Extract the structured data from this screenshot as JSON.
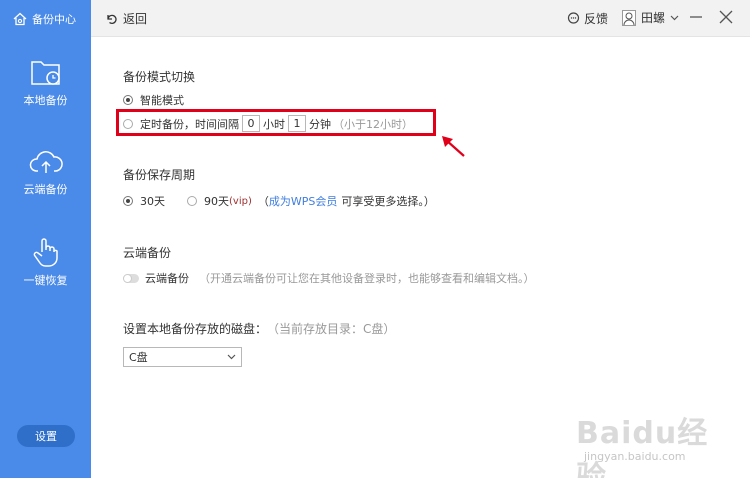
{
  "sidebar": {
    "brand": "备份中心",
    "items": [
      {
        "label": "本地备份",
        "icon": "folder-clock-icon"
      },
      {
        "label": "云端备份",
        "icon": "cloud-upload-icon"
      },
      {
        "label": "一键恢复",
        "icon": "hand-pointer-icon"
      }
    ],
    "settings_label": "设置"
  },
  "topbar": {
    "back_label": "返回",
    "feedback_label": "反馈",
    "user_name": "田螺"
  },
  "mode": {
    "title": "备份模式切换",
    "smart_label": "智能模式",
    "timed_label": "定时备份，时间间隔",
    "hours_value": "0",
    "hours_unit": "小时",
    "minutes_value": "1",
    "minutes_unit": "分钟",
    "hint": "（小于12小时）",
    "selected": "smart"
  },
  "retention": {
    "title": "备份保存周期",
    "opt30": "30天",
    "opt90": "90天",
    "vip_tag": "(vip)",
    "paren_open": "（",
    "member_link": "成为WPS会员",
    "member_suffix": "可享受更多选择。）",
    "selected": "30"
  },
  "cloud": {
    "title": "云端备份",
    "toggle_label": "云端备份",
    "desc": "（开通云端备份可让您在其他设备登录时，也能够查看和编辑文档。）",
    "enabled": false
  },
  "disk": {
    "title": "设置本地备份存放的磁盘：",
    "current": "（当前存放目录：C盘）",
    "selected": "C盘"
  },
  "watermark": {
    "logo": "Baidu经验",
    "sub": "jingyan.baidu.com"
  },
  "colors": {
    "sidebar": "#4a8ae8",
    "highlight": "#e0001a",
    "link": "#3f7ee0"
  }
}
